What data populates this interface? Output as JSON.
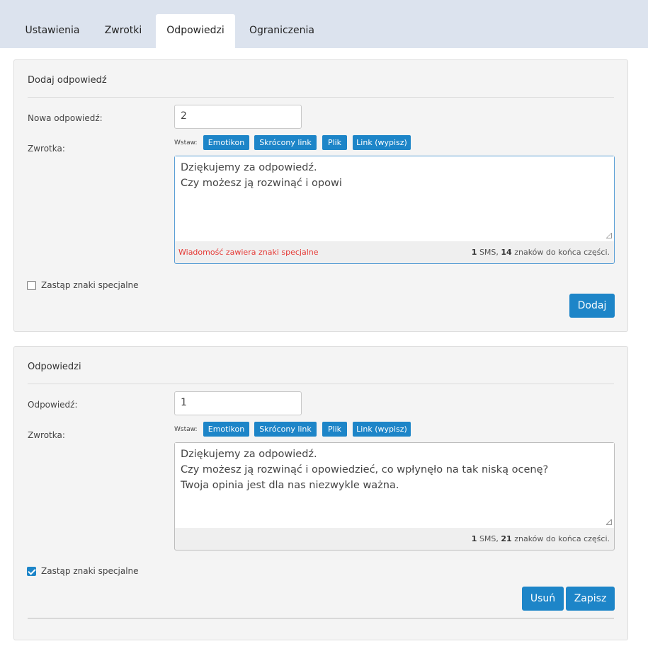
{
  "tabs": [
    {
      "label": "Ustawienia"
    },
    {
      "label": "Zwrotki"
    },
    {
      "label": "Odpowiedzi",
      "active": true
    },
    {
      "label": "Ograniczenia"
    }
  ],
  "add_panel": {
    "title": "Dodaj odpowiedź",
    "new_answer_label": "Nowa odpowiedź:",
    "new_answer_value": "2",
    "reply_label": "Zwrotka:",
    "insert_label": "Wstaw:",
    "insert_buttons": [
      "Emotikon",
      "Skrócony link",
      "Plik",
      "Link (wypisz)"
    ],
    "textarea": "Dziękujemy za odpowiedź.\nCzy możesz ją rozwinąć i opowi",
    "warning": "Wiadomość zawiera znaki specjalne",
    "sms_count": "1",
    "sms_text": " SMS, ",
    "chars_count": "14",
    "chars_text": " znaków do końca części.",
    "replace_label": "Zastąp znaki specjalne",
    "replace_checked": false,
    "add_button": "Dodaj"
  },
  "list_panel": {
    "title": "Odpowiedzi",
    "answer_label": "Odpowiedź:",
    "answer_value": "1",
    "reply_label": "Zwrotka:",
    "insert_label": "Wstaw:",
    "insert_buttons": [
      "Emotikon",
      "Skrócony link",
      "Plik",
      "Link (wypisz)"
    ],
    "textarea": "Dziękujemy za odpowiedź.\nCzy możesz ją rozwinąć i opowiedzieć, co wpłynęło na tak niską ocenę?\nTwoja opinia jest dla nas niezwykle ważna.",
    "sms_count": "1",
    "sms_text": " SMS, ",
    "chars_count": "21",
    "chars_text": " znaków do końca części.",
    "replace_label": "Zastąp znaki specjalne",
    "replace_checked": true,
    "delete_button": "Usuń",
    "save_button": "Zapisz"
  },
  "colors": {
    "accent": "#1d85c8",
    "tabbar_bg": "#dce3ee",
    "panel_bg": "#f4f4f4",
    "warning": "#e53935"
  }
}
